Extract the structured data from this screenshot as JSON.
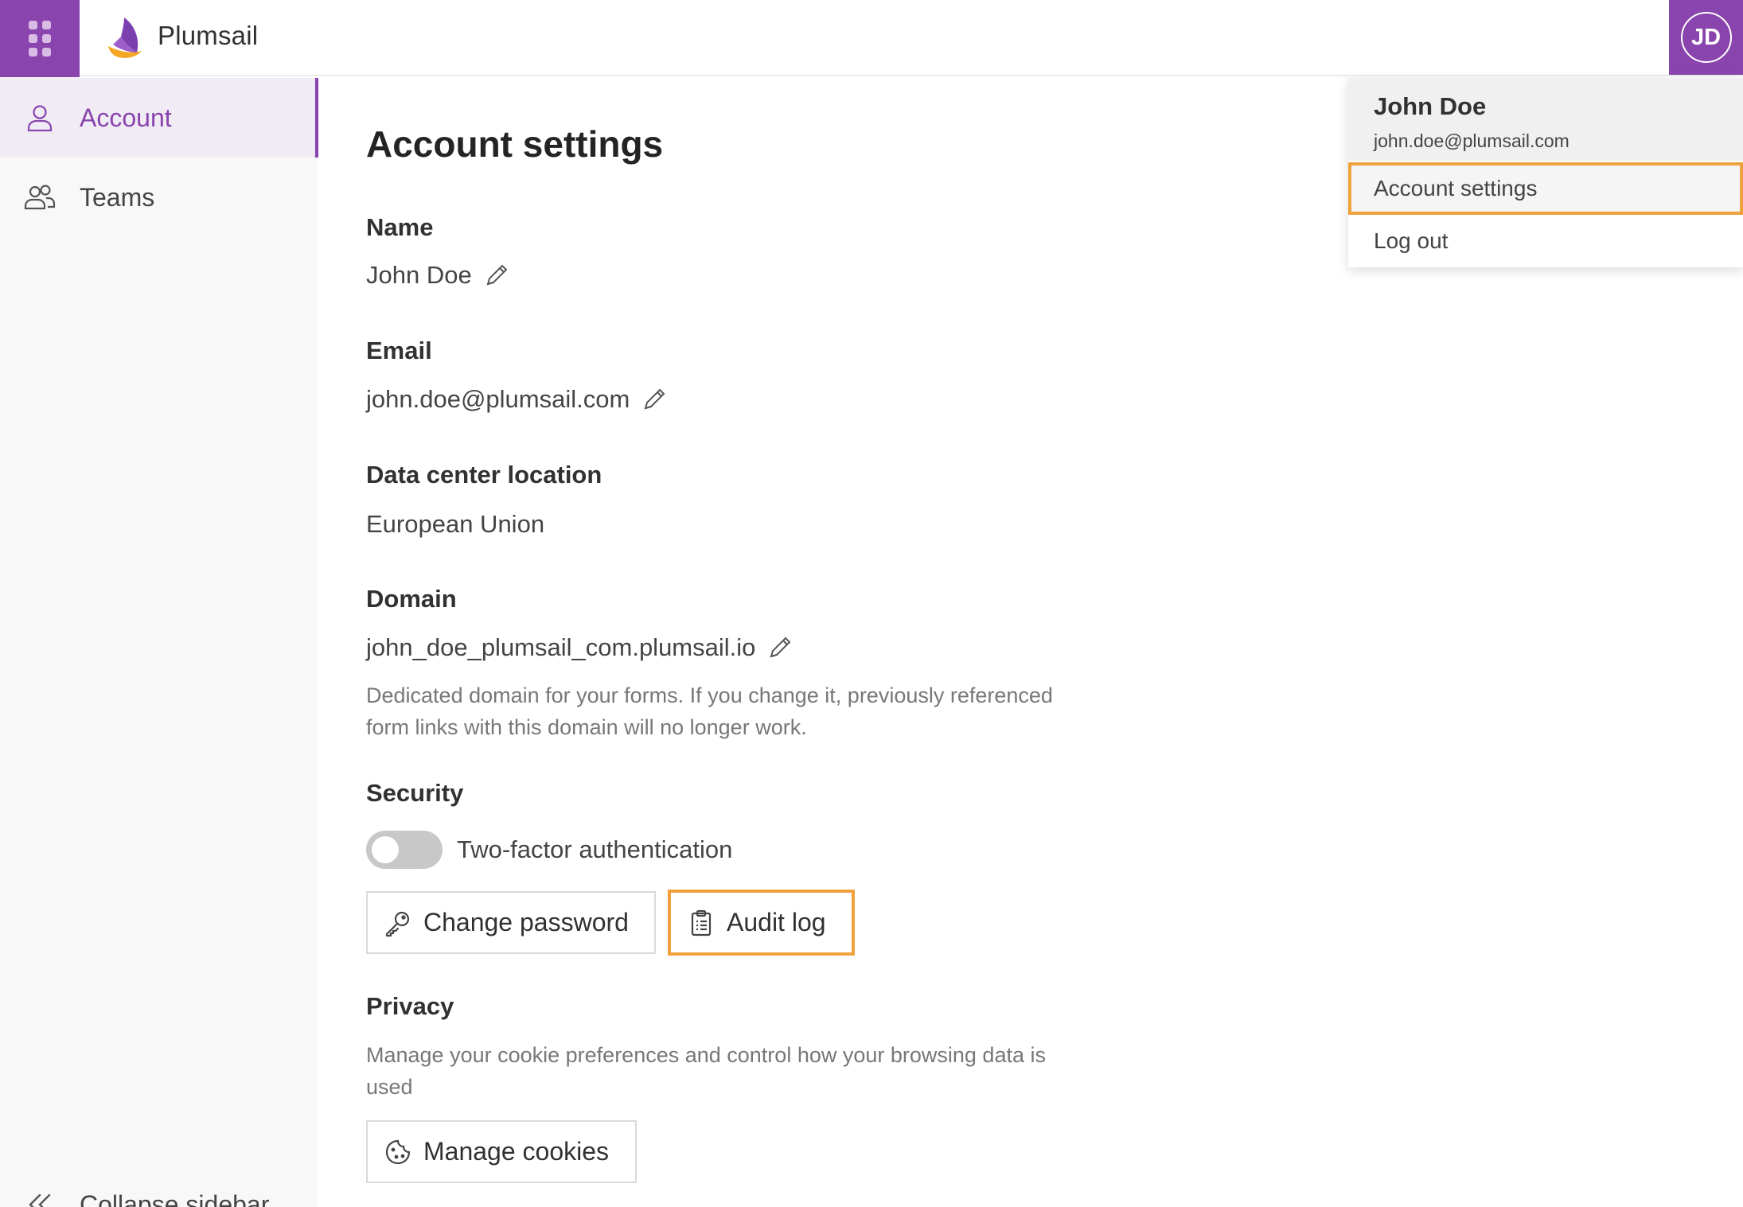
{
  "topbar": {
    "brand": "Plumsail",
    "avatar_initials": "JD"
  },
  "sidebar": {
    "items": [
      {
        "label": "Account",
        "icon": "user-icon",
        "active": true
      },
      {
        "label": "Teams",
        "icon": "users-icon",
        "active": false
      }
    ],
    "collapse_label": "Collapse sidebar"
  },
  "main": {
    "title": "Account settings",
    "name": {
      "label": "Name",
      "value": "John Doe"
    },
    "email": {
      "label": "Email",
      "value": "john.doe@plumsail.com"
    },
    "data_center": {
      "label": "Data center location",
      "value": "European Union"
    },
    "domain": {
      "label": "Domain",
      "value": "john_doe_plumsail_com.plumsail.io",
      "help_line1": "Dedicated domain for your forms. If you change it, previously referenced",
      "help_line2": "form links with this domain will no longer work."
    },
    "security": {
      "label": "Security",
      "two_factor_label": "Two-factor authentication",
      "two_factor_enabled": false,
      "change_password_label": "Change password",
      "audit_log_label": "Audit log"
    },
    "privacy": {
      "label": "Privacy",
      "help_line1": "Manage your cookie preferences and control how your browsing data is",
      "help_line2": "used",
      "manage_cookies_label": "Manage cookies"
    }
  },
  "dropdown": {
    "user_name": "John Doe",
    "user_email": "john.doe@plumsail.com",
    "items": [
      {
        "label": "Account settings",
        "highlighted": true
      },
      {
        "label": "Log out",
        "highlighted": false
      }
    ]
  },
  "colors": {
    "accent": "#8a44ad",
    "highlight": "#f0a03c",
    "logo_orange": "#f5a623"
  }
}
